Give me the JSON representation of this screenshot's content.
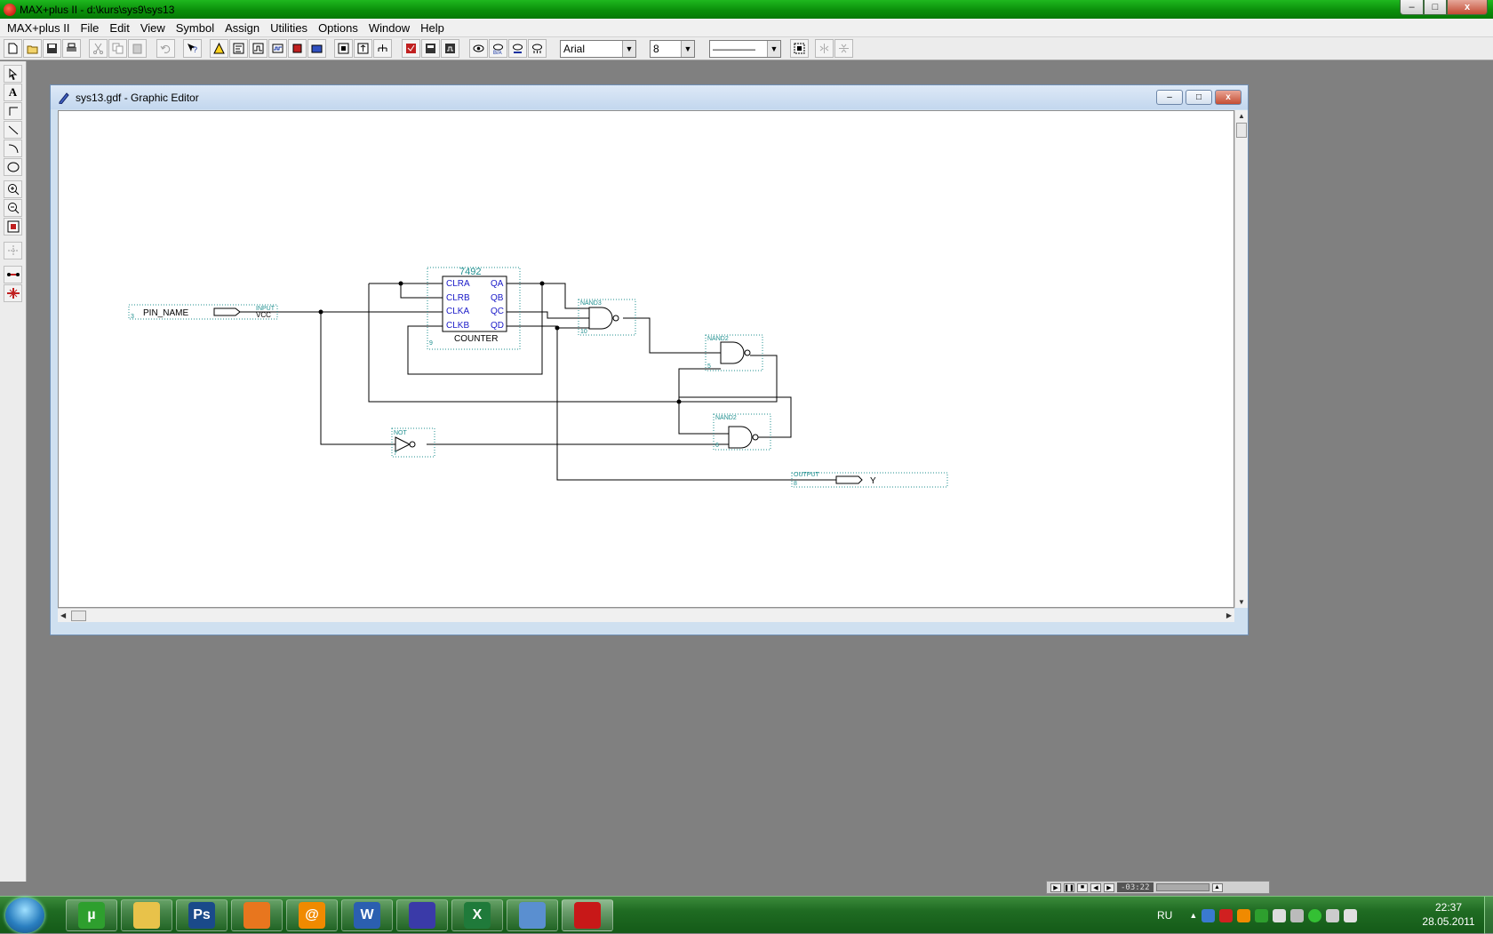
{
  "window": {
    "title": "MAX+plus II - d:\\kurs\\sys9\\sys13",
    "min_glyph": "–",
    "max_glyph": "□",
    "close_glyph": "x"
  },
  "menu": [
    "MAX+plus II",
    "File",
    "Edit",
    "View",
    "Symbol",
    "Assign",
    "Utilities",
    "Options",
    "Window",
    "Help"
  ],
  "toolbar": {
    "buttons": [
      "new-icon",
      "open-icon",
      "save-icon",
      "print-icon",
      "cut-icon",
      "copy-icon",
      "paste-icon",
      "undo-icon",
      "help-icon",
      "hierarchy-icon",
      "compiler-icon",
      "simulator-icon",
      "timing-icon",
      "programmer-icon",
      "project-icon",
      "open-project-icon",
      "save-check-icon",
      "save-compile-icon",
      "save-simulate-icon",
      "floorplan-icon",
      "search-icon",
      "find-node-icon",
      "replace-icon",
      "show-guide-icon"
    ],
    "font": "Arial",
    "size": "8",
    "line_style": "————"
  },
  "palette": [
    "arrow-tool-icon",
    "text-tool-icon",
    "orthogonal-line-icon",
    "diagonal-line-icon",
    "arc-tool-icon",
    "circle-tool-icon",
    "zoom-in-icon",
    "zoom-out-icon",
    "fit-window-icon",
    "rubberband-icon",
    "connect-dot-icon",
    "split-dot-icon"
  ],
  "editor": {
    "title": "sys13.gdf - Graphic Editor",
    "schematic": {
      "input_pin": {
        "name": "PIN_NAME",
        "type": "INPUT",
        "default": "VCC",
        "id": "3"
      },
      "counter": {
        "part": "7492",
        "label": "COUNTER",
        "id": "9",
        "inputs": [
          "CLRA",
          "CLRB",
          "CLKA",
          "CLKB"
        ],
        "outputs": [
          "QA",
          "QB",
          "QC",
          "QD"
        ]
      },
      "nand3": {
        "type": "NAND3",
        "id": "10"
      },
      "nand2_a": {
        "type": "NAND2",
        "id": "5"
      },
      "nand2_b": {
        "type": "NAND2",
        "id": "6"
      },
      "not_gate": {
        "type": "NOT",
        "id": "7"
      },
      "output_pin": {
        "type": "OUTPUT",
        "name": "Y",
        "id": "8"
      }
    }
  },
  "media": {
    "time": "-03:22"
  },
  "taskbar": {
    "apps": [
      {
        "name": "utorrent",
        "label": "µ",
        "color": "#2e9f2e"
      },
      {
        "name": "explorer",
        "label": "",
        "color": "#e8c24a"
      },
      {
        "name": "photoshop",
        "label": "Ps",
        "color": "#1a4a8a"
      },
      {
        "name": "firefox",
        "label": "",
        "color": "#e8761e"
      },
      {
        "name": "mail-agent",
        "label": "@",
        "color": "#f08a00"
      },
      {
        "name": "word",
        "label": "W",
        "color": "#2b5fb0"
      },
      {
        "name": "maxplus-editor",
        "label": "",
        "color": "#3a3aa8"
      },
      {
        "name": "excel",
        "label": "X",
        "color": "#1f7a3a"
      },
      {
        "name": "downloader",
        "label": "",
        "color": "#5a8fd0"
      },
      {
        "name": "maxplus",
        "label": "",
        "color": "#c81818"
      }
    ],
    "lang": "RU",
    "time": "22:37",
    "date": "28.05.2011"
  }
}
